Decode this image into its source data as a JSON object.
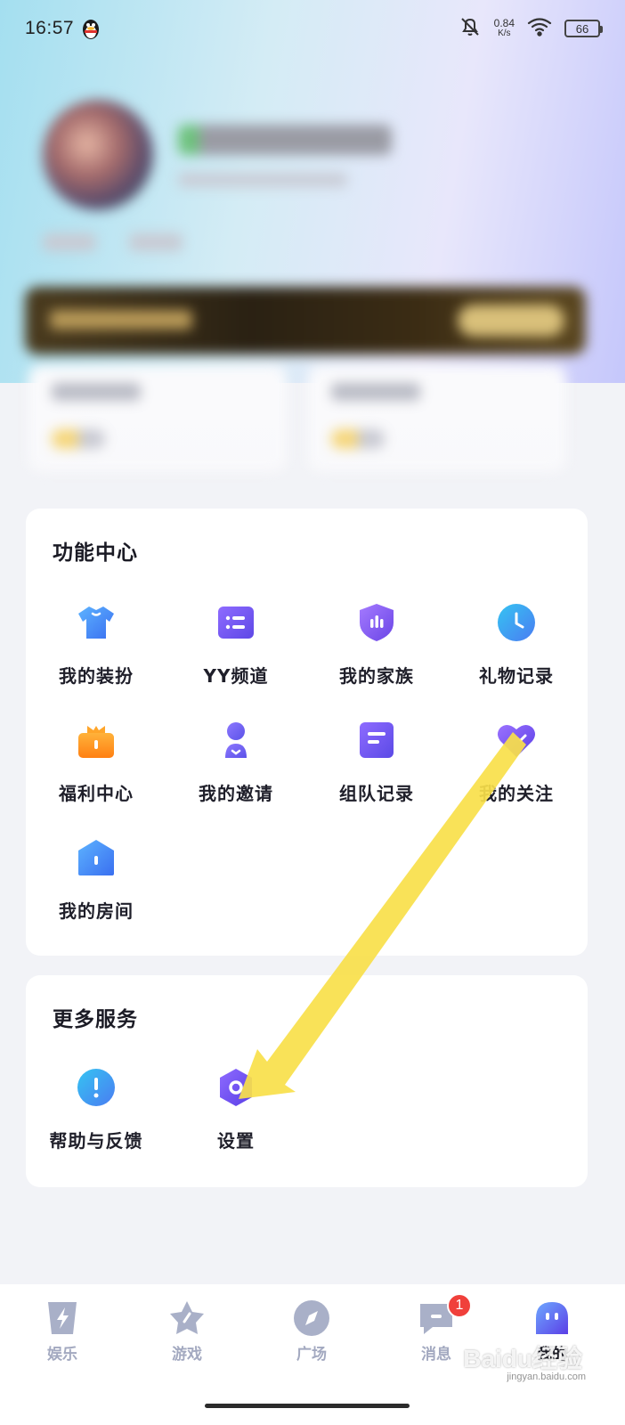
{
  "status_bar": {
    "time": "16:57",
    "net_speed_value": "0.84",
    "net_speed_unit": "K/s",
    "battery": "66"
  },
  "function_center": {
    "title": "功能中心",
    "items": [
      {
        "label": "我的装扮",
        "icon": "shirt-icon",
        "color": "#4a8ff5"
      },
      {
        "label": "YY频道",
        "icon": "channel-list-icon",
        "color": "#7c5cf2"
      },
      {
        "label": "我的家族",
        "icon": "family-shield-icon",
        "color": "#8a58f0"
      },
      {
        "label": "礼物记录",
        "icon": "clock-icon",
        "color": "#3aa8f5"
      },
      {
        "label": "福利中心",
        "icon": "gift-icon",
        "color": "#ff9a1f"
      },
      {
        "label": "我的邀请",
        "icon": "invite-person-icon",
        "color": "#6f62f0"
      },
      {
        "label": "组队记录",
        "icon": "team-record-icon",
        "color": "#6d5df2"
      },
      {
        "label": "我的关注",
        "icon": "heart-icon",
        "color": "#7b4ff0"
      },
      {
        "label": "我的房间",
        "icon": "house-icon",
        "color": "#4a8ff5"
      }
    ]
  },
  "more_services": {
    "title": "更多服务",
    "items": [
      {
        "label": "帮助与反馈",
        "icon": "help-exclamation-icon",
        "color": "#3aa8f5"
      },
      {
        "label": "设置",
        "icon": "settings-hexagon-icon",
        "color": "#6d55f2"
      }
    ]
  },
  "bottom_nav": {
    "items": [
      {
        "label": "娱乐",
        "icon": "lightning-icon",
        "active": false
      },
      {
        "label": "游戏",
        "icon": "star-icon",
        "active": false
      },
      {
        "label": "广场",
        "icon": "compass-icon",
        "active": false
      },
      {
        "label": "消息",
        "icon": "message-icon",
        "active": false,
        "badge": "1"
      },
      {
        "label": "我的",
        "icon": "ghost-profile-icon",
        "active": true
      }
    ]
  },
  "watermark": {
    "text": "Baidu经验",
    "sub": "jingyan.baidu.com"
  },
  "colors": {
    "accent_purple": "#6d55f2",
    "accent_blue": "#3aa8f5",
    "badge_red": "#f0403b",
    "annotation_arrow": "#f9e04a"
  }
}
